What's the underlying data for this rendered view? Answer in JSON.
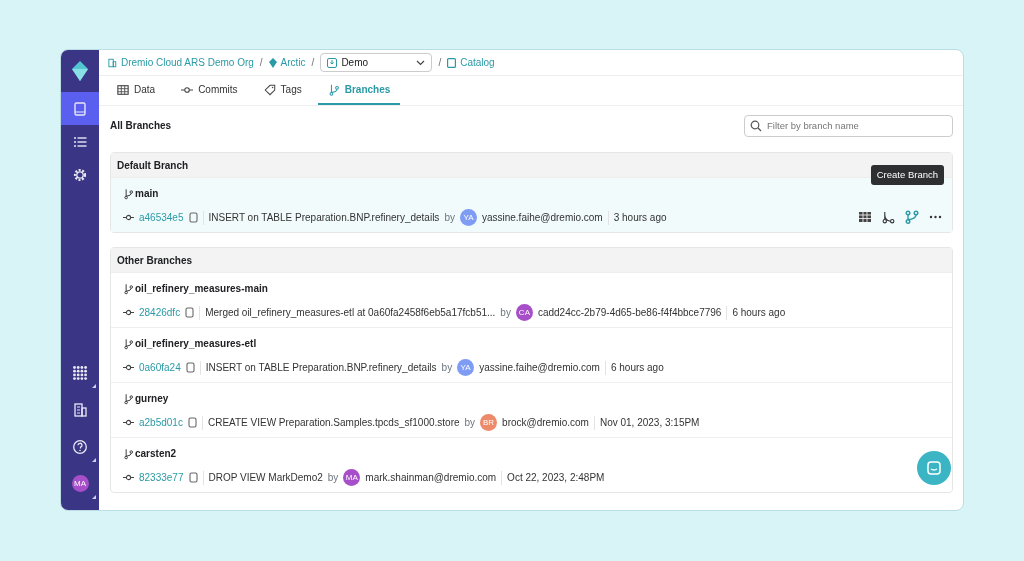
{
  "breadcrumb": {
    "org": "Dremio Cloud ARS Demo Org",
    "catalog": "Arctic",
    "branch_select": "Demo",
    "link": "Catalog",
    "separators": [
      "/",
      "/",
      "/"
    ]
  },
  "tabs": [
    {
      "label": "Data",
      "kind": "data",
      "selected": false
    },
    {
      "label": "Commits",
      "kind": "commits",
      "selected": false
    },
    {
      "label": "Tags",
      "kind": "tags",
      "selected": false
    },
    {
      "label": "Branches",
      "kind": "branches",
      "selected": true
    }
  ],
  "sidebar": {
    "items": [
      {
        "kind": "catalog",
        "selected": true,
        "menu": false
      },
      {
        "kind": "jobs",
        "selected": false,
        "menu": false
      },
      {
        "kind": "settings",
        "selected": false,
        "menu": false
      }
    ],
    "bottom_items": [
      {
        "kind": "apps",
        "menu": true
      },
      {
        "kind": "organization",
        "menu": false
      },
      {
        "kind": "help",
        "menu": true
      },
      {
        "kind": "avatar",
        "initials": "MA",
        "menu": true
      }
    ]
  },
  "heading": "All Branches",
  "search": {
    "placeholder": "Filter by branch name"
  },
  "sections": [
    {
      "title": "Default Branch",
      "branches": [
        {
          "name": "main",
          "hash": "a46534e5",
          "message": "INSERT on TABLE Preparation.BNP.refinery_details",
          "by": "by",
          "initials": "YA",
          "color": "#7f9cf5",
          "author": "yassine.faihe@dremio.com",
          "time": "3 hours ago",
          "hovered": true
        }
      ]
    },
    {
      "title": "Other Branches",
      "branches": [
        {
          "name": "oil_refinery_measures-main",
          "hash": "28426dfc",
          "message": "Merged oil_refinery_measures-etl at 0a60fa2458f6eb5a17fcb51...",
          "by": "by",
          "initials": "CA",
          "color": "#a64fc8",
          "author": "cadd24cc-2b79-4d65-be86-f4f4bbce7796",
          "time": "6 hours ago",
          "hovered": false
        },
        {
          "name": "oil_refinery_measures-etl",
          "hash": "0a60fa24",
          "message": "INSERT on TABLE Preparation.BNP.refinery_details",
          "by": "by",
          "initials": "YA",
          "color": "#7f9cf5",
          "author": "yassine.faihe@dremio.com",
          "time": "6 hours ago",
          "hovered": false
        },
        {
          "name": "gurney",
          "hash": "a2b5d01c",
          "message": "CREATE VIEW Preparation.Samples.tpcds_sf1000.store",
          "by": "by",
          "initials": "BR",
          "color": "#ec8a6a",
          "author": "brock@dremio.com",
          "time": "Nov 01, 2023, 3:15PM",
          "hovered": false
        },
        {
          "name": "carsten2",
          "hash": "82333e77",
          "message": "DROP VIEW MarkDemo2",
          "by": "by",
          "initials": "MA",
          "color": "#a64fc8",
          "author": "mark.shainman@dremio.com",
          "time": "Oct 22, 2023, 2:48PM",
          "hovered": false
        }
      ]
    }
  ],
  "tooltip": "Create Branch"
}
